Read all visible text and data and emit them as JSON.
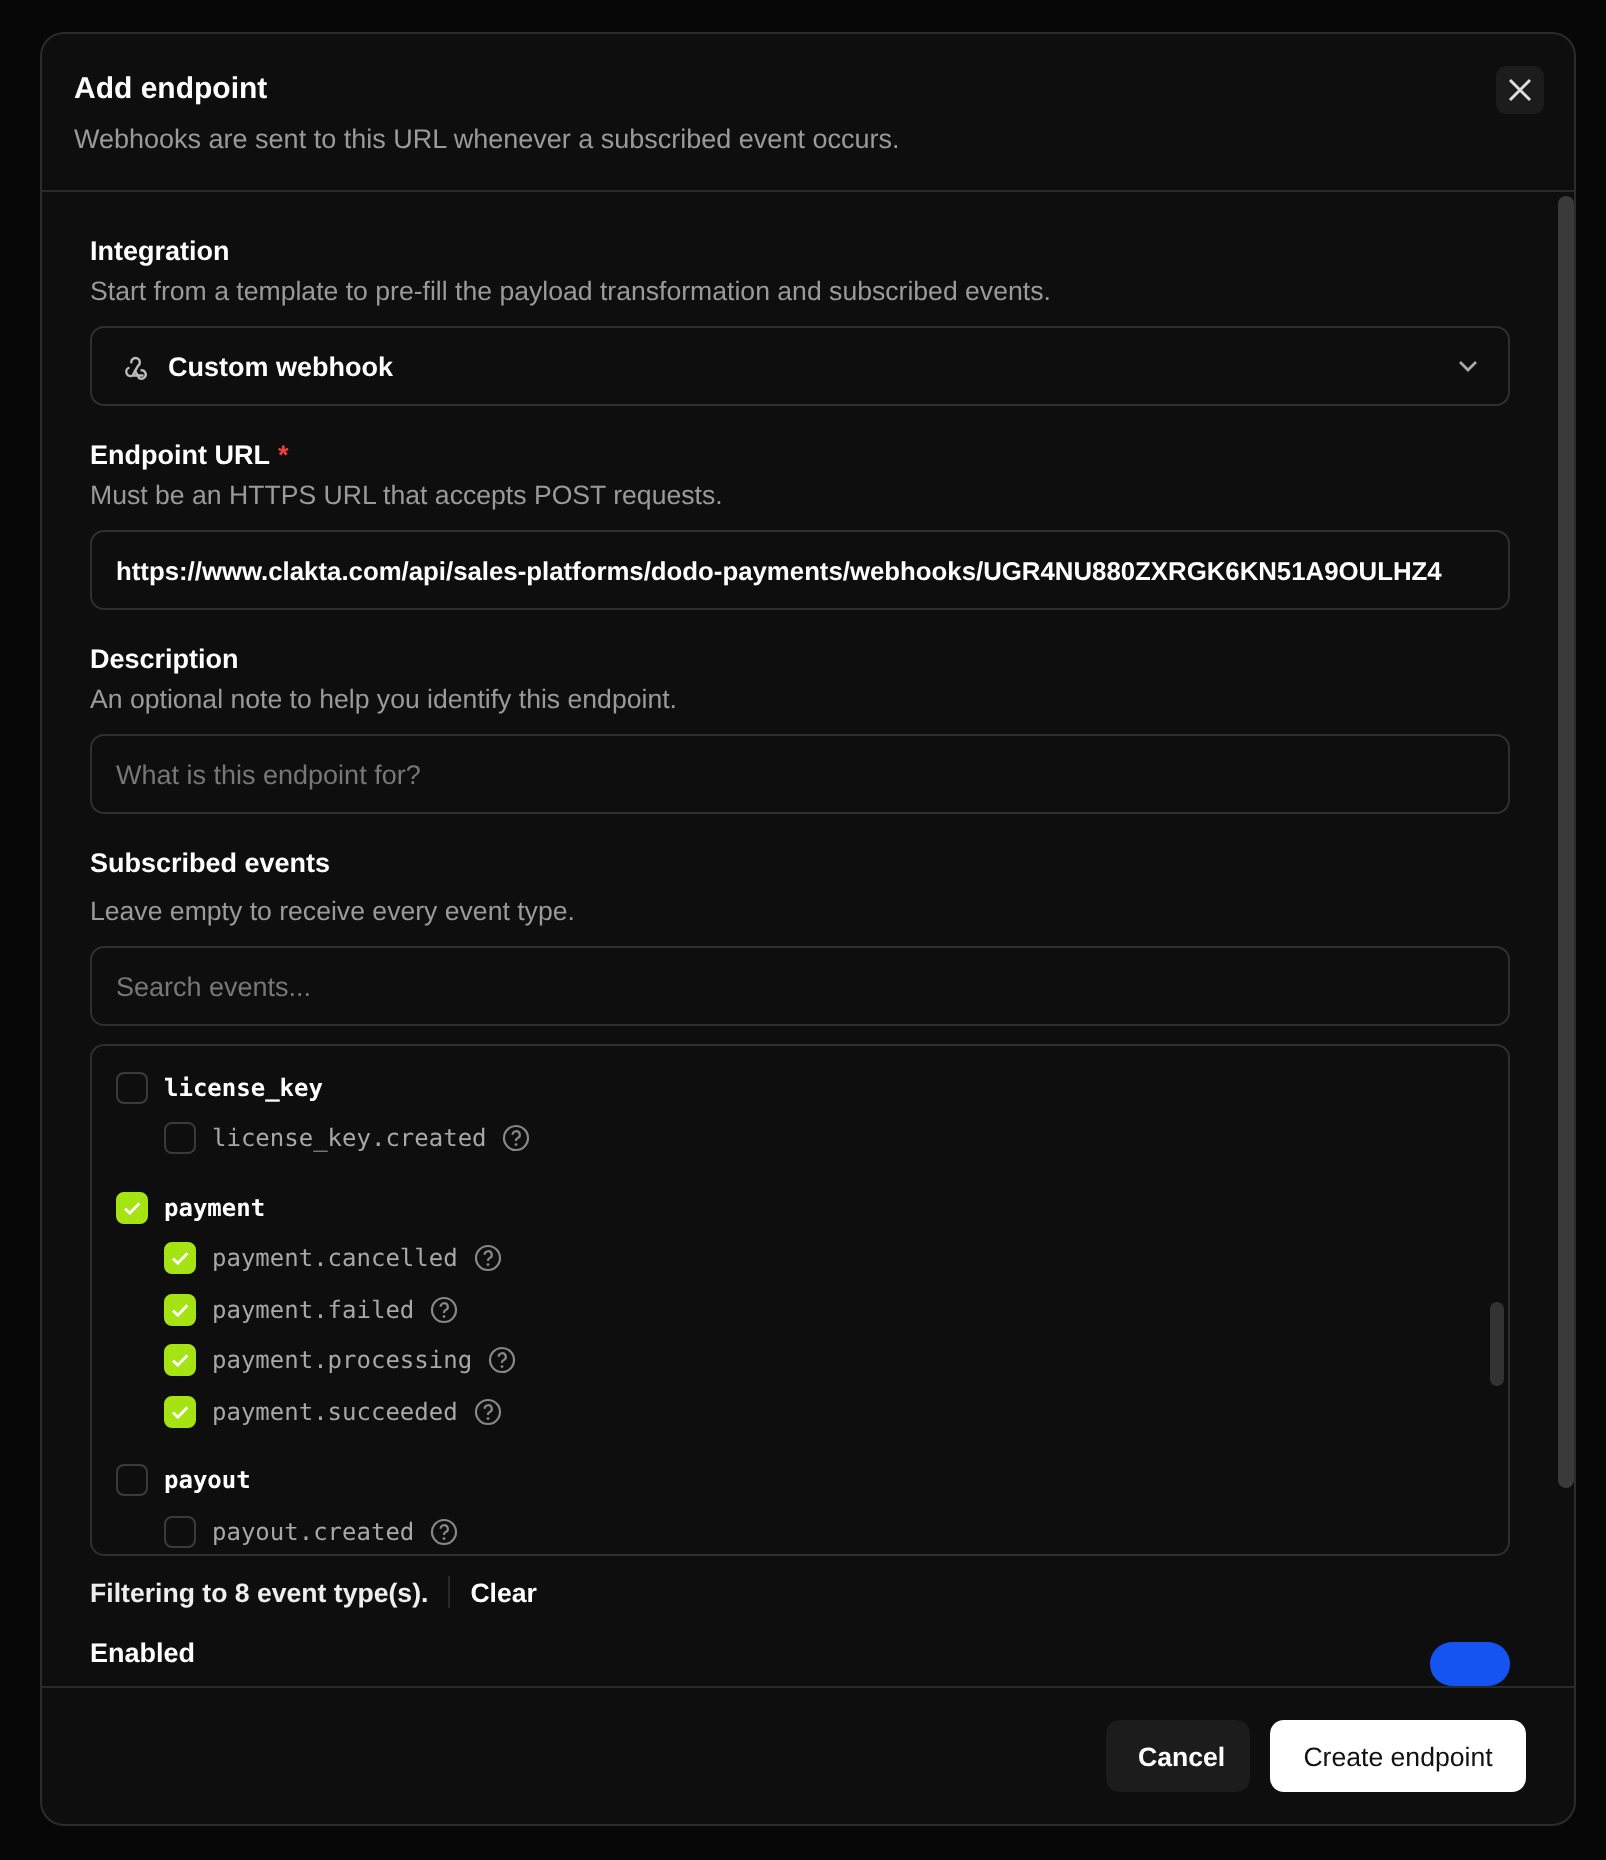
{
  "dialog": {
    "title": "Add endpoint",
    "subtitle": "Webhooks are sent to this URL whenever a subscribed event occurs."
  },
  "fields": [
    {
      "kind": "select",
      "label": "Integration",
      "help": "Start from a template to pre-fill the payload transformation and subscribed events.",
      "value": "Custom webhook"
    },
    {
      "kind": "input",
      "label": "Endpoint URL",
      "required_mark": "*",
      "help": "Must be an HTTPS URL that accepts POST requests.",
      "value": "https://www.clakta.com/api/sales-platforms/dodo-payments/webhooks/UGR4NU880ZXRGK6KN51A9OULHZ4"
    },
    {
      "kind": "input",
      "label": "Description",
      "help": "An optional note to help you identify this endpoint.",
      "placeholder": "What is this endpoint for?"
    }
  ],
  "events": {
    "label": "Subscribed events",
    "help": "Leave empty to receive every event type.",
    "search_placeholder": "Search events...",
    "groups": [
      {
        "name": "license_key",
        "checked": false,
        "children": [
          {
            "name": "license_key.created",
            "checked": false
          }
        ]
      },
      {
        "name": "payment",
        "checked": true,
        "children": [
          {
            "name": "payment.cancelled",
            "checked": true
          },
          {
            "name": "payment.failed",
            "checked": true
          },
          {
            "name": "payment.processing",
            "checked": true
          },
          {
            "name": "payment.succeeded",
            "checked": true
          }
        ]
      },
      {
        "name": "payout",
        "checked": false,
        "children": [
          {
            "name": "payout.created",
            "checked": false
          }
        ]
      }
    ],
    "filter_note": "Filtering to 8 event type(s).",
    "clear": "Clear"
  },
  "enabled": {
    "label": "Enabled",
    "on": true
  },
  "buttons": [
    {
      "label": "Cancel",
      "kind": "secondary"
    },
    {
      "label": "Create endpoint",
      "kind": "primary"
    }
  ]
}
